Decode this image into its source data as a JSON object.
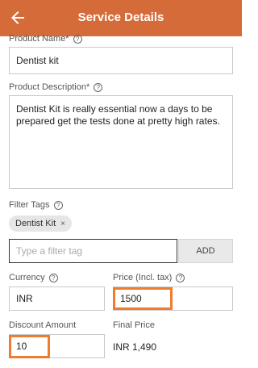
{
  "header": {
    "title": "Service Details",
    "back_icon": "arrow-left-icon",
    "color": "#d66b3a"
  },
  "product_name": {
    "label": "Product Name*",
    "value": "Dentist kit"
  },
  "product_description": {
    "label": "Product Description*",
    "line1": "Dentist Kit is really essential now a days to be",
    "line2": "prepared get the tests done at pretty high rates."
  },
  "filter_tags": {
    "label": "Filter Tags",
    "chips": [
      {
        "label": "Dentist Kit",
        "remove": "×"
      }
    ],
    "input_placeholder": "Type a filter tag",
    "add_label": "ADD"
  },
  "currency": {
    "label": "Currency",
    "value": "INR"
  },
  "price": {
    "label": "Price (Incl. tax)",
    "value": "1500"
  },
  "discount": {
    "label": "Discount Amount",
    "value": "10"
  },
  "final_price": {
    "label": "Final Price",
    "value": "INR 1,490"
  },
  "highlight_color": "#f07c2e"
}
